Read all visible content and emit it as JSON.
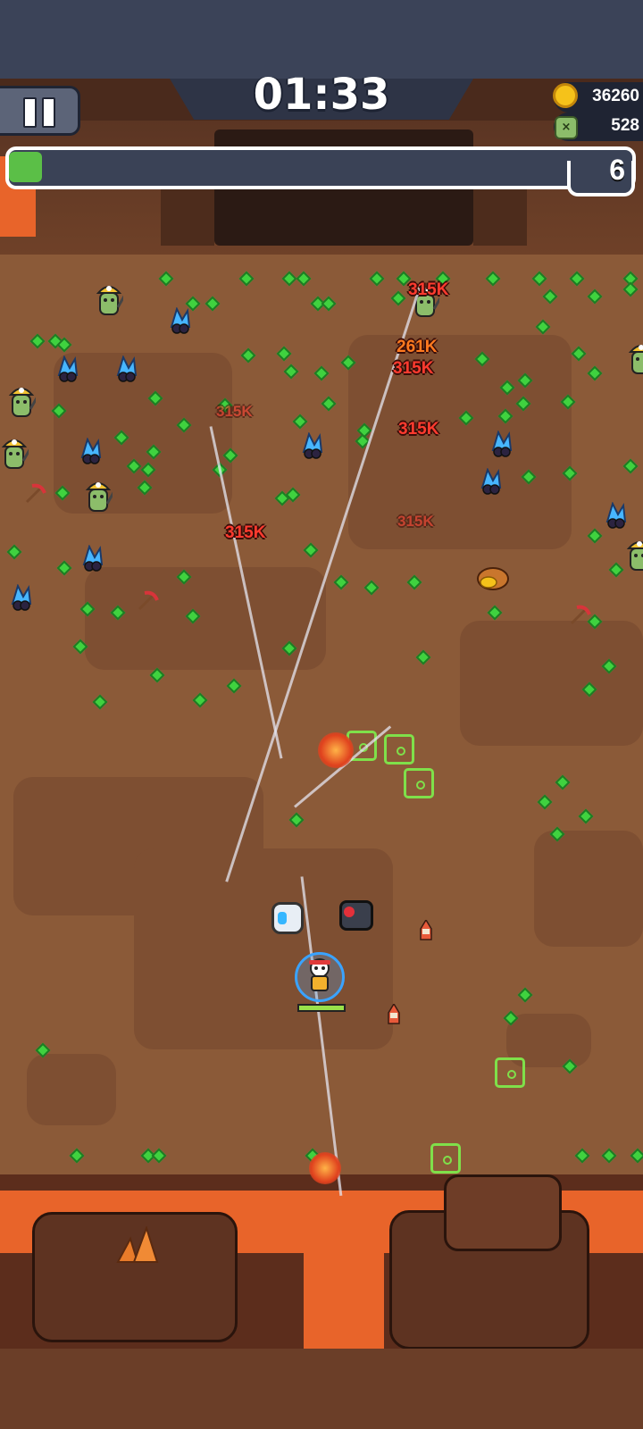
{
  "hud": {
    "timer": "01:33",
    "coins": "36260",
    "kills": "528",
    "level": "6",
    "xp_progress": 0.06
  },
  "icons": {
    "pause": "pause-icon",
    "coin": "coin-icon",
    "kills": "skull-icon"
  },
  "combat_text": [
    {
      "text": "315K",
      "tone": "red"
    },
    {
      "text": "261K",
      "tone": "orange"
    },
    {
      "text": "315K",
      "tone": "red"
    },
    {
      "text": "315K",
      "tone": "red"
    },
    {
      "text": "315K",
      "tone": "red"
    },
    {
      "text": "315K",
      "tone": "red"
    },
    {
      "text": "315K",
      "tone": "red"
    }
  ],
  "colors": {
    "xp_fill": "#5bbf47",
    "gem": "#3fd23f",
    "damage_red": "#ff3b2f",
    "damage_orange": "#ff7a1f",
    "lava": "#e8642a",
    "target_reticle": "#7fe04a"
  }
}
